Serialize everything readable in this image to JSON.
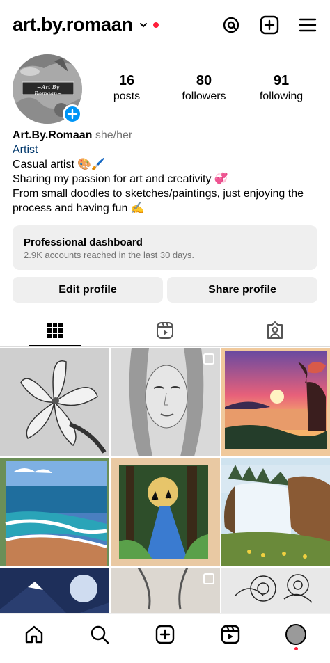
{
  "header": {
    "username": "art.by.romaan",
    "icons": [
      "threads-icon",
      "create-icon",
      "menu-icon"
    ]
  },
  "profile": {
    "stats": [
      {
        "value": "16",
        "label": "posts"
      },
      {
        "value": "80",
        "label": "followers"
      },
      {
        "value": "91",
        "label": "following"
      }
    ],
    "avatar_text": "~Art By Romaan~",
    "name": "Art.By.Romaan",
    "pronouns": "she/her",
    "category": "Artist",
    "bio_lines": [
      "Casual artist 🎨🖌️",
      "Sharing my passion for art and creativity 💞",
      "From small doodles to sketches/paintings, just enjoying the",
      "process and having fun ✍️"
    ]
  },
  "dashboard": {
    "title": "Professional dashboard",
    "subtitle": "2.9K accounts reached in the last 30 days."
  },
  "buttons": {
    "edit": "Edit profile",
    "share": "Share profile"
  },
  "tabs": [
    "grid-icon",
    "reels-icon",
    "tagged-icon"
  ],
  "colors": {
    "accent": "#0095f6",
    "notification": "#ff1f3b",
    "category": "#00376b",
    "muted": "#737373",
    "button_bg": "#efefef"
  },
  "posts": [
    {
      "subject": "lily pencil sketch",
      "multi": false
    },
    {
      "subject": "portrait sketch",
      "multi": true
    },
    {
      "subject": "sunset lake painting",
      "multi": false
    },
    {
      "subject": "beach waves painting",
      "multi": false
    },
    {
      "subject": "forest path painting",
      "multi": false
    },
    {
      "subject": "waterfall painting",
      "multi": false
    },
    {
      "subject": "moon mountain painting",
      "multi": false
    },
    {
      "subject": "pencil sketch",
      "multi": true
    },
    {
      "subject": "floral doodle",
      "multi": false
    }
  ],
  "bottom_nav": [
    "home-icon",
    "search-icon",
    "create-icon",
    "reels-icon",
    "profile-avatar"
  ]
}
